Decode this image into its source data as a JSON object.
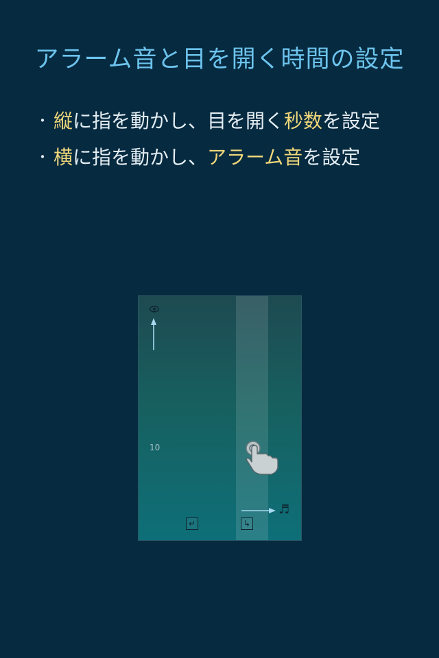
{
  "title": "アラーム音と目を開く時間の設定",
  "bullets": [
    {
      "dot": "・",
      "hl": "縦",
      "mid": "に指を動かし、目を開く",
      "hl2": "秒数",
      "end": "を設定"
    },
    {
      "dot": "・",
      "hl": "横",
      "mid": "に指を動かし、",
      "hl2": "アラーム音",
      "end": "を設定"
    }
  ],
  "mockup": {
    "seconds_value": "10",
    "icons": {
      "eye": "eye-icon",
      "up_arrow": "up-arrow-icon",
      "hand": "tap-hand-icon",
      "right_arrow": "right-arrow-icon",
      "note": "music-note-icon",
      "enter": "return-icon",
      "turn": "turn-icon"
    },
    "note_glyph": "♬",
    "enter_glyph": "↵",
    "turn_glyph": "↳"
  },
  "colors": {
    "background": "#062a40",
    "title": "#6cc3ec",
    "highlight": "#f0d87a",
    "arrow": "#a8d8f0"
  }
}
